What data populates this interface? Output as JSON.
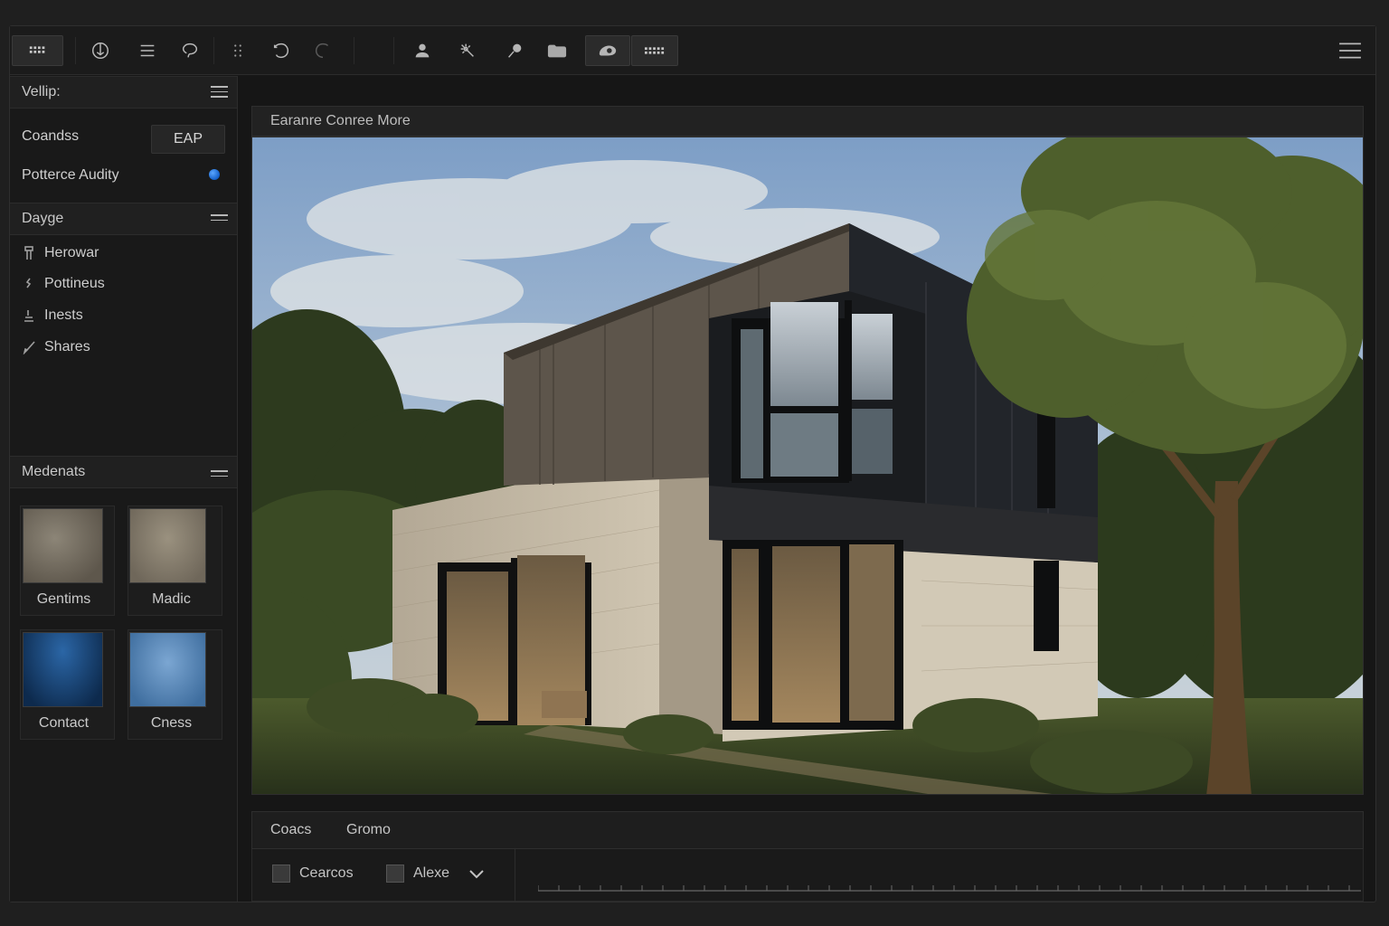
{
  "toolbar": {
    "buttons": [
      "grid-menu-icon",
      "logo-icon",
      "list-icon",
      "lasso-icon",
      "dots-grid-icon",
      "undo-icon",
      "redo-icon",
      "person-icon",
      "magic-wand-icon",
      "pin-tool-icon",
      "folder-icon",
      "camera-icon",
      "keyboard-icon",
      "hamburger-icon"
    ]
  },
  "sidebar": {
    "header1": "Vellip:",
    "conditions_label": "Coandss",
    "conditions_button": "EAP",
    "quality_label": "Potterce Audity",
    "header2": "Dayge",
    "nav_items": [
      {
        "label": "Herowar",
        "icon": "tube-icon"
      },
      {
        "label": "Pottineus",
        "icon": "squiggle-icon"
      },
      {
        "label": "Inests",
        "icon": "stack-icon"
      },
      {
        "label": "Shares",
        "icon": "brush-icon"
      }
    ],
    "header3": "Medenats",
    "materials": [
      {
        "label": "Gentims",
        "color": "#7c7467"
      },
      {
        "label": "Madic",
        "color": "#8a8172"
      },
      {
        "label": "Contact",
        "color": "#1f4f87"
      },
      {
        "label": "Cness",
        "color": "#5d8bbd"
      }
    ]
  },
  "viewport": {
    "title": "Earanre Conree More"
  },
  "bottom": {
    "tabs": [
      "Coacs",
      "Gromo"
    ],
    "checkbox1": "Cearcos",
    "checkbox2": "Alexe"
  },
  "colors": {
    "background": "#161616",
    "panel": "#202020",
    "accent": "#1e6fd9"
  }
}
